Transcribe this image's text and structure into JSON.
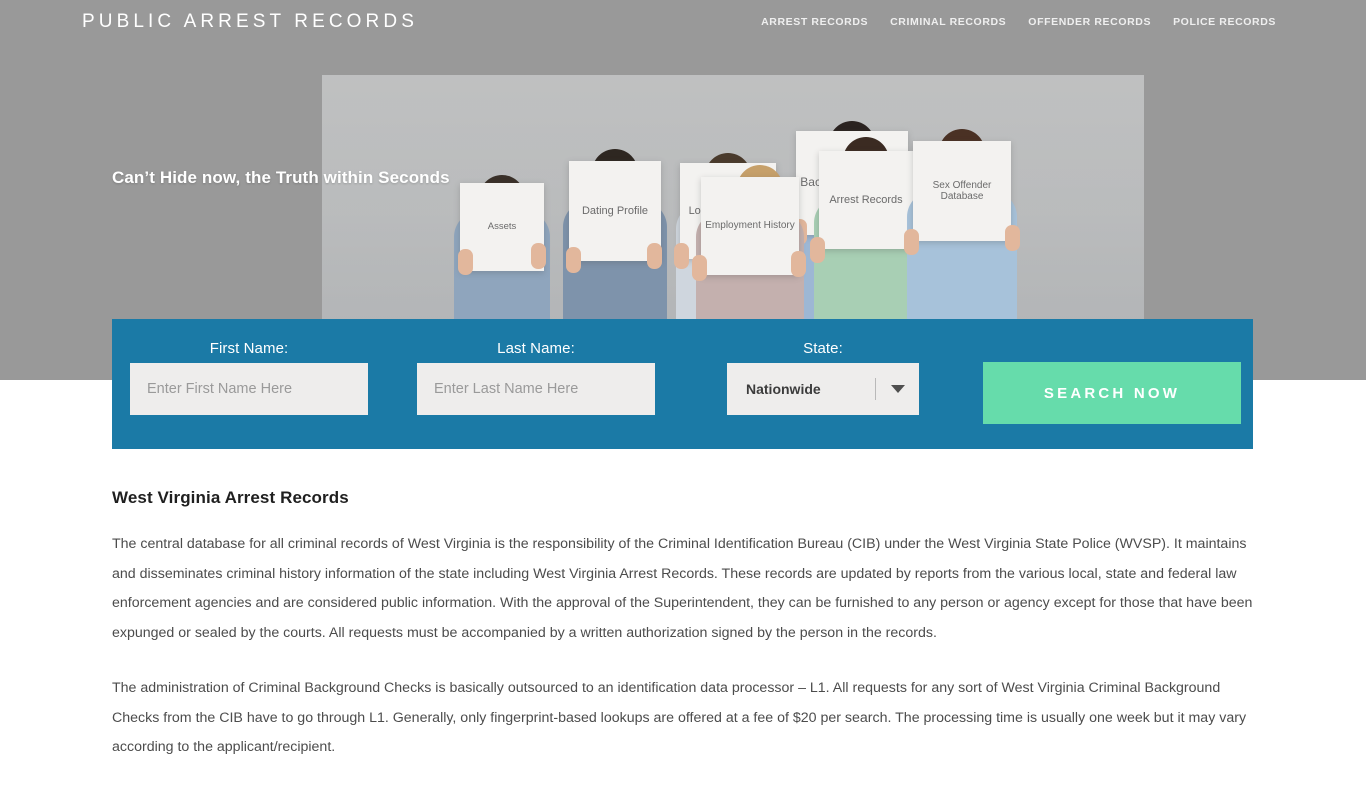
{
  "header": {
    "logo": "PUBLIC ARREST RECORDS",
    "nav": [
      {
        "label": "ARREST RECORDS"
      },
      {
        "label": "CRIMINAL RECORDS"
      },
      {
        "label": "OFFENDER RECORDS"
      },
      {
        "label": "POLICE RECORDS"
      }
    ]
  },
  "hero": {
    "tagline": "Can’t Hide now, the Truth within Seconds",
    "signs": [
      {
        "text": "Assets"
      },
      {
        "text": "Dating Profile"
      },
      {
        "text": "Location History"
      },
      {
        "text": "Background Report"
      },
      {
        "text": "Employment History"
      },
      {
        "text": "Arrest Records"
      },
      {
        "text": "Sex Offender Database"
      }
    ]
  },
  "search": {
    "first_name_label": "First Name:",
    "first_name_placeholder": "Enter First Name Here",
    "first_name_value": "",
    "last_name_label": "Last Name:",
    "last_name_placeholder": "Enter Last Name Here",
    "last_name_value": "",
    "state_label": "State:",
    "state_value": "Nationwide",
    "submit_label": "SEARCH NOW"
  },
  "article": {
    "heading": "West Virginia Arrest Records",
    "paragraph1": "The central database for all criminal records of West Virginia is the responsibility of the Criminal Identification Bureau (CIB) under the West Virginia State Police (WVSP). It maintains and disseminates criminal history information of the state including West Virginia Arrest Records. These records are updated by reports from the various local, state and federal law enforcement agencies and are considered public information. With the approval of the Superintendent, they can be furnished to any person or agency except for those that have been expunged or sealed by the courts. All requests must be accompanied by a written authorization signed by the person in the records.",
    "paragraph2": "The administration of Criminal Background Checks is basically outsourced to an identification data processor – L1. All requests for any sort of West Virginia Criminal Background Checks from the CIB have to go through L1. Generally, only fingerprint-based lookups are offered at a fee of $20 per search. The processing time is usually one week but it may vary according to the applicant/recipient."
  },
  "colors": {
    "band": "#999999",
    "form_blue": "#1b7aa6",
    "button_green": "#66dcab",
    "input_gray": "#eeedec"
  }
}
